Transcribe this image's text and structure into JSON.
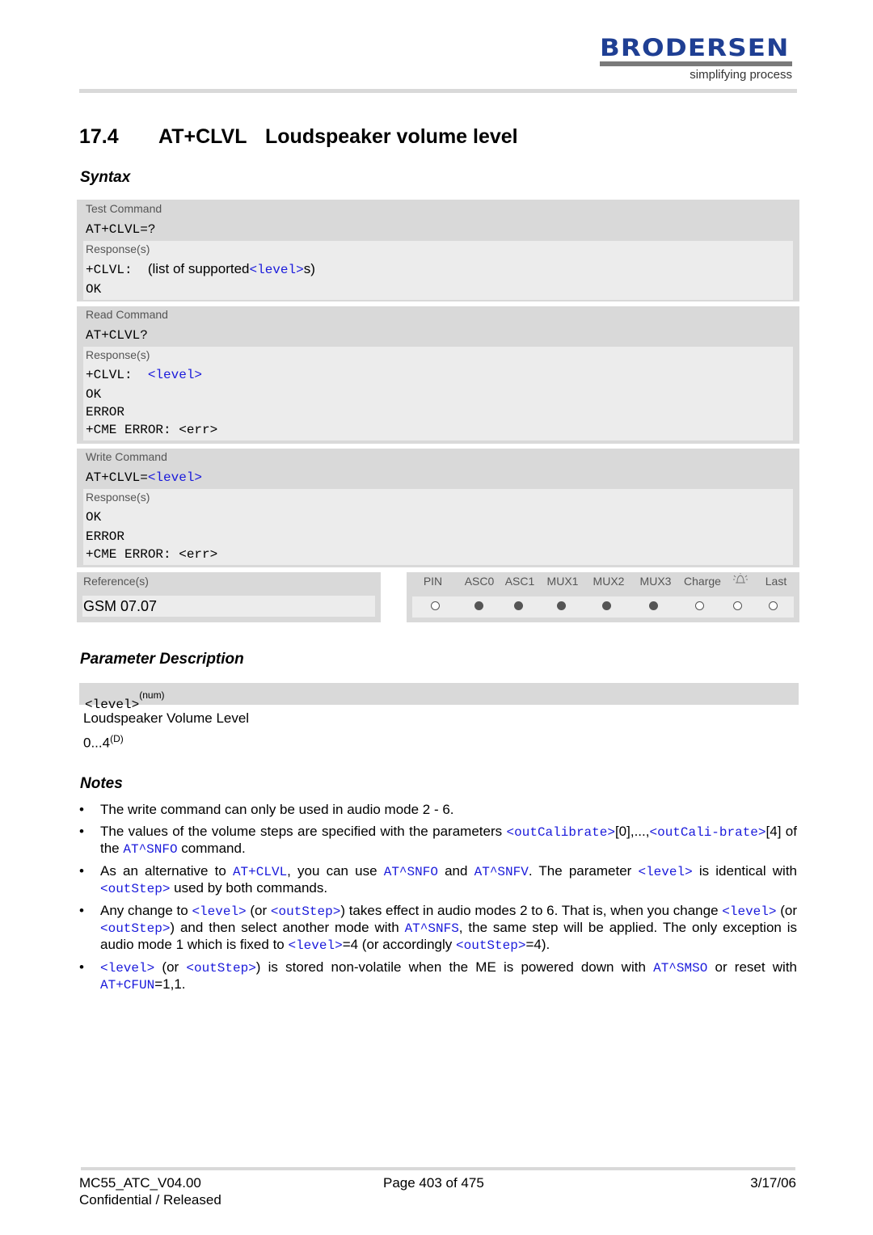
{
  "header": {
    "logo_text": "BRODERSEN",
    "logo_tagline": "simplifying process"
  },
  "title": {
    "number": "17.4",
    "command": "AT+CLVL",
    "text": "Loudspeaker volume level"
  },
  "syntax_heading": "Syntax",
  "test": {
    "label": "Test Command",
    "command": "AT+CLVL=?",
    "response_label": "Response(s)",
    "resp_prefix": "+CLVL:  ",
    "resp_text": "(list of supported",
    "resp_param": "<level>",
    "resp_suffix": "s)",
    "ok": "OK"
  },
  "read": {
    "label": "Read Command",
    "command": "AT+CLVL?",
    "response_label": "Response(s)",
    "resp_prefix": "+CLVL:  ",
    "resp_param": "<level>",
    "lines": [
      "OK",
      "ERROR",
      "+CME ERROR: <err>"
    ]
  },
  "write": {
    "label": "Write Command",
    "command_prefix": "AT+CLVL=",
    "command_param": "<level>",
    "response_label": "Response(s)",
    "lines": [
      "OK",
      "ERROR",
      "+CME ERROR: <err>"
    ]
  },
  "reference": {
    "label": "Reference(s)",
    "value": "GSM 07.07"
  },
  "flags": {
    "columns": [
      "PIN",
      "ASC0",
      "ASC1",
      "MUX1",
      "MUX2",
      "MUX3",
      "Charge",
      "alarm-bell-icon",
      "Last"
    ],
    "values": [
      false,
      true,
      true,
      true,
      true,
      true,
      false,
      false,
      false
    ]
  },
  "param_heading": "Parameter Description",
  "param": {
    "name": "<level>",
    "type": "(num)",
    "description": "Loudspeaker Volume Level",
    "range": "0...4",
    "default_mark": "(D)"
  },
  "notes_heading": "Notes",
  "notes": [
    [
      {
        "t": "The write command can only be used in audio mode 2 - 6."
      }
    ],
    [
      {
        "t": "The values of the volume steps are specified with the parameters "
      },
      {
        "t": "<outCalibrate>",
        "c": 1
      },
      {
        "t": "[0],...,"
      },
      {
        "t": "<outCali-brate>",
        "c": 1
      },
      {
        "t": "[4] of the "
      },
      {
        "t": "AT^SNFO",
        "c": 1
      },
      {
        "t": " command."
      }
    ],
    [
      {
        "t": "As an alternative to "
      },
      {
        "t": "AT+CLVL",
        "c": 1
      },
      {
        "t": ", you can use "
      },
      {
        "t": "AT^SNFO",
        "c": 1
      },
      {
        "t": " and "
      },
      {
        "t": "AT^SNFV",
        "c": 1
      },
      {
        "t": ". The parameter "
      },
      {
        "t": "<level>",
        "c": 1
      },
      {
        "t": " is identical with "
      },
      {
        "t": "<outStep>",
        "c": 1
      },
      {
        "t": " used by both commands."
      }
    ],
    [
      {
        "t": "Any change to "
      },
      {
        "t": "<level>",
        "c": 1
      },
      {
        "t": " (or "
      },
      {
        "t": "<outStep>",
        "c": 1
      },
      {
        "t": ") takes effect in audio modes 2 to 6. That is, when you change "
      },
      {
        "t": "<level>",
        "c": 1
      },
      {
        "t": " (or "
      },
      {
        "t": "<outStep>",
        "c": 1
      },
      {
        "t": ") and then select another mode with "
      },
      {
        "t": "AT^SNFS",
        "c": 1
      },
      {
        "t": ", the same step will be applied. The only exception is audio mode 1 which is fixed to "
      },
      {
        "t": "<level>",
        "c": 1
      },
      {
        "t": "=4 (or accordingly "
      },
      {
        "t": "<outStep>",
        "c": 1
      },
      {
        "t": "=4)."
      }
    ],
    [
      {
        "t": "<level>",
        "c": 1
      },
      {
        "t": " (or "
      },
      {
        "t": "<outStep>",
        "c": 1
      },
      {
        "t": ") is stored non-volatile when the ME is powered down with "
      },
      {
        "t": "AT^SMSO",
        "c": 1
      },
      {
        "t": " or reset with "
      },
      {
        "t": "AT+CFUN",
        "c": 1
      },
      {
        "t": "=1,1."
      }
    ]
  ],
  "footer": {
    "doc": "MC55_ATC_V04.00",
    "status": "Confidential / Released",
    "page": "Page 403 of 475",
    "date": "3/17/06"
  },
  "colors": {
    "brand": "#1f3f93",
    "link": "#1a1adb",
    "box": "#d9d9d9",
    "box_inner": "#ececec"
  }
}
